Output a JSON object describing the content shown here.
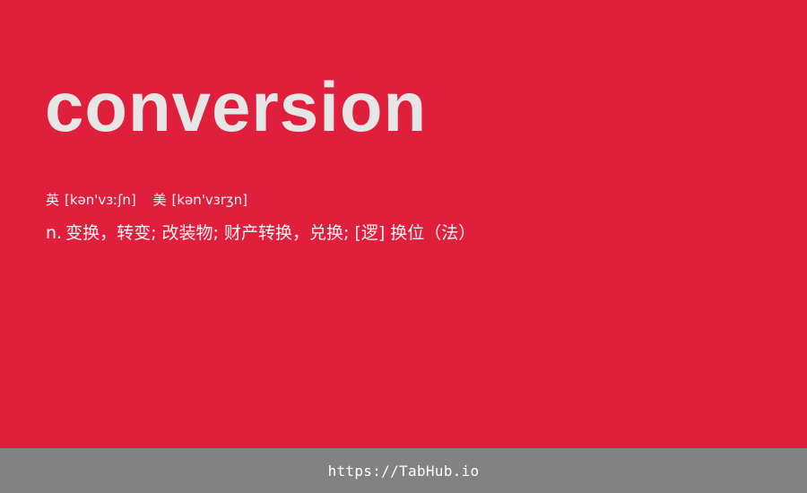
{
  "word": "conversion",
  "phonetics": {
    "uk": {
      "region": "英",
      "ipa": "[kən'vɜːʃn]"
    },
    "us": {
      "region": "美",
      "ipa": "[kən'vɜrʒn]"
    }
  },
  "definition": {
    "pos": "n.",
    "meaning": "变换，转变; 改装物; 财产转换，兑换; [逻] 换位（法）"
  },
  "footer": {
    "url": "https://TabHub.io"
  },
  "colors": {
    "background": "#e01f3d",
    "word": "#e6e6e6",
    "text": "#f4f4f4",
    "footer_bg": "#828282"
  }
}
